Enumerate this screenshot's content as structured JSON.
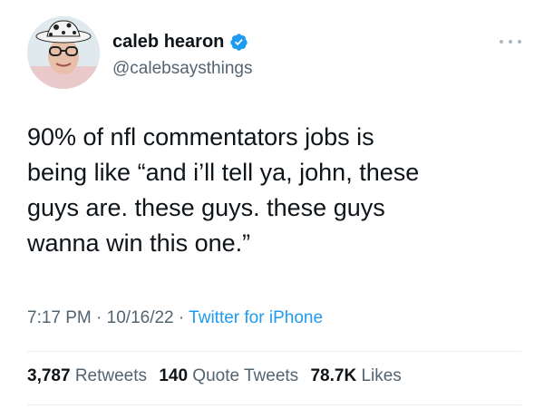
{
  "user": {
    "display_name": "caleb hearon",
    "handle": "@calebsaysthings",
    "verified": true
  },
  "tweet": {
    "text_lines": [
      "90% of nfl commentators jobs is",
      "being like “and i’ll tell ya, john, these",
      "guys are. these guys. these guys",
      "wanna win this one.”"
    ],
    "time": "7:17 PM",
    "date": "10/16/22",
    "source": "Twitter for iPhone",
    "separator": "·"
  },
  "stats": {
    "retweets_count": "3,787",
    "retweets_label": "Retweets",
    "quote_count": "140",
    "quote_label": "Quote Tweets",
    "likes_count": "78.7K",
    "likes_label": "Likes"
  },
  "colors": {
    "text": "#0f1419",
    "secondary": "#536471",
    "accent": "#1d9bf0"
  },
  "icons": [
    "avatar",
    "verified-badge-icon",
    "more-options-icon"
  ]
}
